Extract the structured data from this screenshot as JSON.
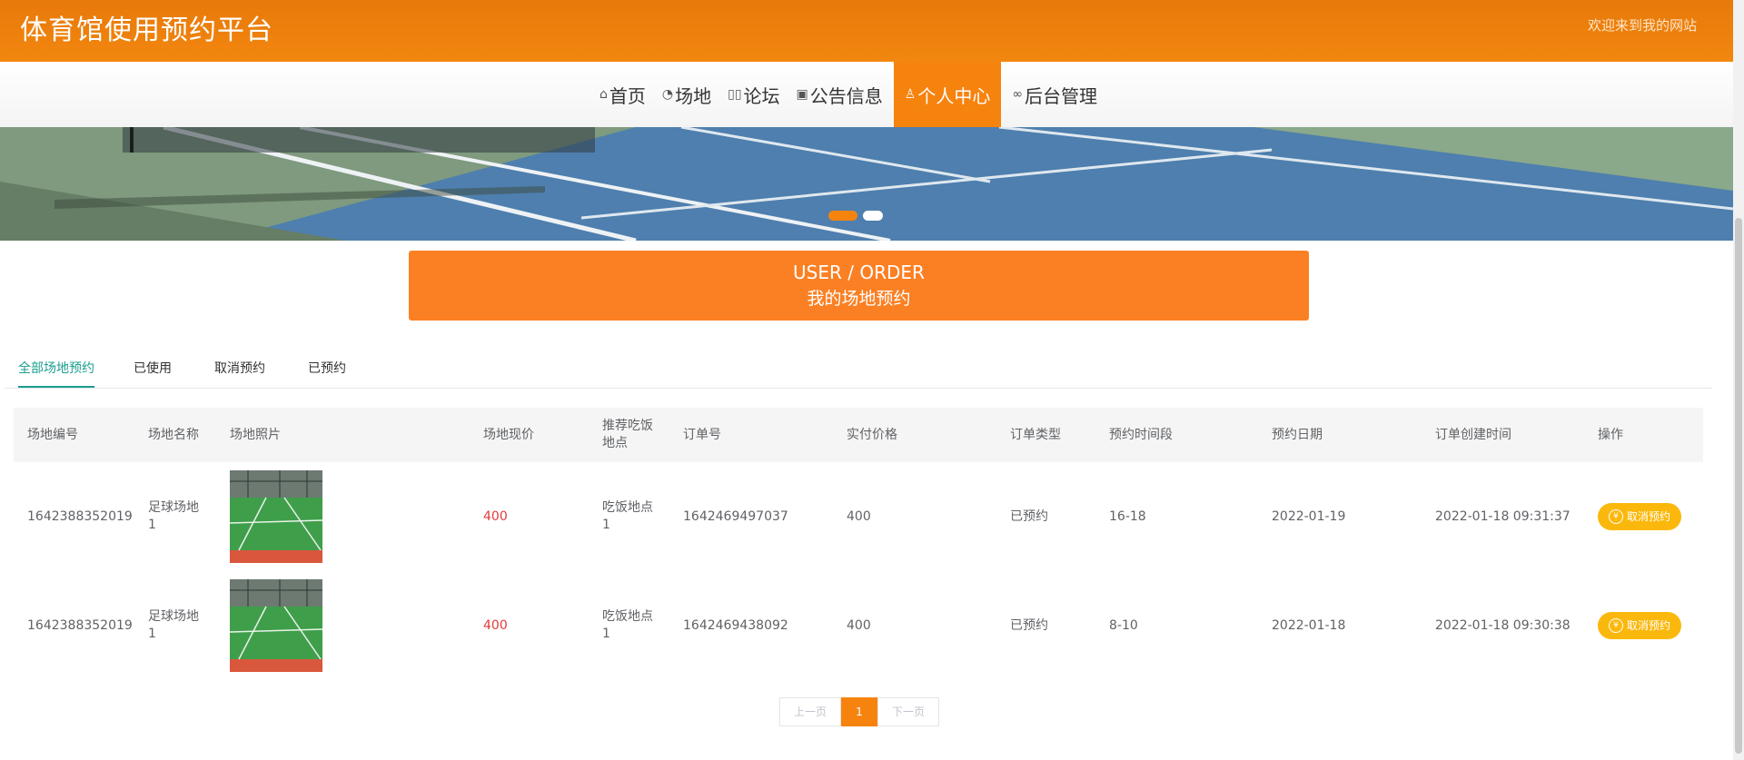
{
  "header": {
    "site_title": "体育馆使用预约平台",
    "welcome": "欢迎来到我的网站"
  },
  "nav": {
    "items": [
      {
        "label": "首页",
        "icon": "home-icon"
      },
      {
        "label": "场地",
        "icon": "gauge-icon"
      },
      {
        "label": "论坛",
        "icon": "forum-icon"
      },
      {
        "label": "公告信息",
        "icon": "gift-icon"
      },
      {
        "label": "个人中心",
        "icon": "user-icon",
        "active": true
      },
      {
        "label": "后台管理",
        "icon": "link-icon"
      }
    ]
  },
  "section": {
    "title_en": "USER / ORDER",
    "title_cn": "我的场地预约"
  },
  "tabs": [
    {
      "label": "全部场地预约",
      "active": true
    },
    {
      "label": "已使用"
    },
    {
      "label": "取消预约"
    },
    {
      "label": "已预约"
    }
  ],
  "table": {
    "headers": [
      "场地编号",
      "场地名称",
      "场地照片",
      "场地现价",
      "推荐吃饭地点",
      "订单号",
      "实付价格",
      "订单类型",
      "预约时间段",
      "预约日期",
      "订单创建时间",
      "操作"
    ],
    "rows": [
      {
        "venue_no": "1642388352019",
        "venue_name": "足球场地1",
        "price": "400",
        "dining": "吃饭地点1",
        "order_no": "1642469497037",
        "paid": "400",
        "order_type": "已预约",
        "time_slot": "16-18",
        "date": "2022-01-19",
        "created": "2022-01-18 09:31:37",
        "action": "取消预约"
      },
      {
        "venue_no": "1642388352019",
        "venue_name": "足球场地1",
        "price": "400",
        "dining": "吃饭地点1",
        "order_no": "1642469438092",
        "paid": "400",
        "order_type": "已预约",
        "time_slot": "8-10",
        "date": "2022-01-18",
        "created": "2022-01-18 09:30:38",
        "action": "取消预约"
      }
    ]
  },
  "pager": {
    "prev": "上一页",
    "current": "1",
    "next": "下一页"
  },
  "colors": {
    "brand_orange": "#f7830f",
    "tab_active": "#1a9e8f",
    "price_red": "#e33b3b",
    "cancel_yellow": "#fbb80c"
  }
}
